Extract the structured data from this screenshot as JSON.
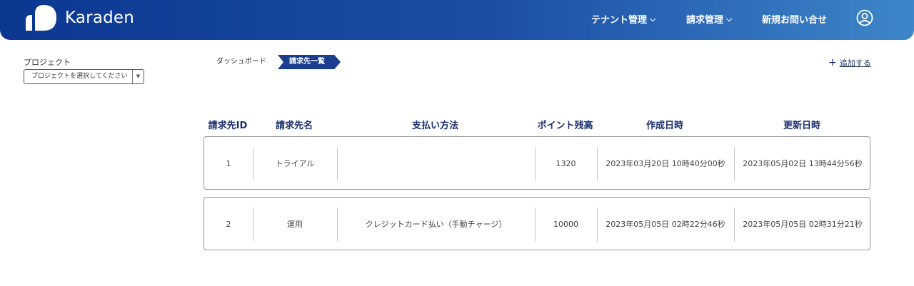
{
  "brand": {
    "name": "Karaden"
  },
  "nav": {
    "tenant": "テナント管理",
    "billing": "請求管理",
    "inquiry": "新規お問い合せ",
    "user_icon": "user-circle-icon"
  },
  "project": {
    "label": "プロジェクト",
    "placeholder": "プロジェクトを選択してください"
  },
  "breadcrumb": {
    "dashboard": "ダッシュボード",
    "current": "請求先一覧"
  },
  "actions": {
    "add": "追加する"
  },
  "table": {
    "headers": [
      "請求先ID",
      "請求先名",
      "支払い方法",
      "ポイント残高",
      "作成日時",
      "更新日時"
    ],
    "rows": [
      {
        "id": "1",
        "name": "トライアル",
        "payment": "",
        "points": "1320",
        "created": "2023年03月20日 10時40分00秒",
        "updated": "2023年05月02日 13時44分56秒"
      },
      {
        "id": "2",
        "name": "運用",
        "payment": "クレジットカード払い（手動チャージ）",
        "points": "10000",
        "created": "2023年05月05日 02時22分46秒",
        "updated": "2023年05月05日 02時31分21秒"
      }
    ]
  }
}
